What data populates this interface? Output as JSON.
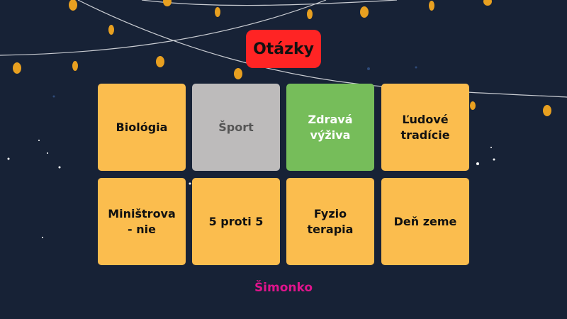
{
  "title": "Otázky",
  "colors": {
    "background": "#172236",
    "title_bg": "#ff2424",
    "orange": "#fbbd4e",
    "gray": "#bdbbbb",
    "green": "#76bd5a",
    "author": "#e0148c"
  },
  "tiles": [
    {
      "label": "Biológia",
      "bg": "#fbbd4e",
      "fg": "#111111"
    },
    {
      "label": "Šport",
      "bg": "#bdbbbb",
      "fg": "#555555"
    },
    {
      "label": "Zdravá\nvýživa",
      "bg": "#76bd5a",
      "fg": "#ffffff"
    },
    {
      "label": "Ľudové\ntradície",
      "bg": "#fbbd4e",
      "fg": "#111111"
    },
    {
      "label": "Miništrova\n- nie",
      "bg": "#fbbd4e",
      "fg": "#111111"
    },
    {
      "label": "5 proti 5",
      "bg": "#fbbd4e",
      "fg": "#111111"
    },
    {
      "label": "Fyzio\nterapia",
      "bg": "#fbbd4e",
      "fg": "#111111"
    },
    {
      "label": "Deň zeme",
      "bg": "#fbbd4e",
      "fg": "#111111"
    }
  ],
  "author": "Šimonko"
}
